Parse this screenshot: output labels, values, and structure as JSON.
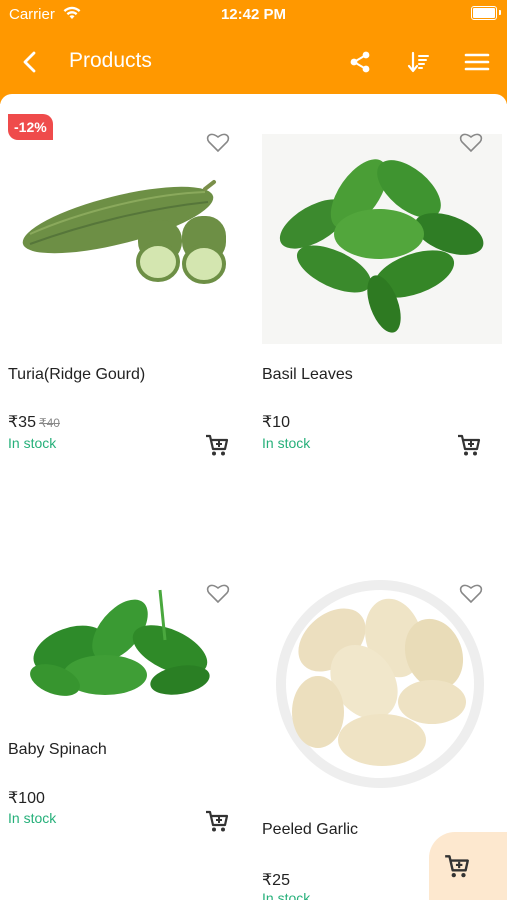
{
  "status_bar": {
    "carrier": "Carrier",
    "time": "12:42 PM"
  },
  "header": {
    "title": "Products",
    "icons": [
      "back-arrow-icon",
      "share-icon",
      "sort-icon",
      "menu-icon"
    ]
  },
  "colors": {
    "header": "#ff9800",
    "badge": "#ef4b4b",
    "in_stock": "#26b07a",
    "fab_bg": "#fde8cf"
  },
  "products": [
    {
      "name": "Turia(Ridge Gourd)",
      "price": "₹35",
      "mrp": "₹40",
      "discount": "-12%",
      "stock": "In stock"
    },
    {
      "name": "Basil Leaves",
      "price": "₹10",
      "stock": "In stock"
    },
    {
      "name": "Baby Spinach",
      "price": "₹100",
      "stock": "In stock"
    },
    {
      "name": "Peeled Garlic",
      "price": "₹25",
      "stock": "In stock"
    }
  ]
}
